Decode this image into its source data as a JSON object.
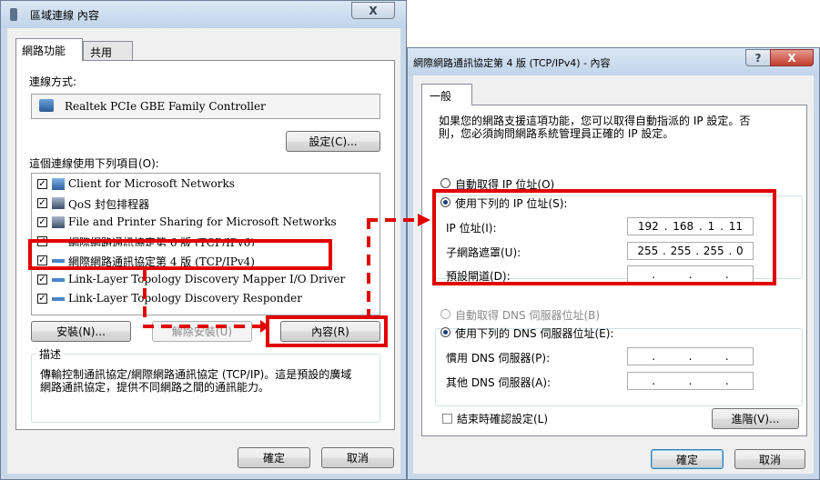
{
  "left_window": {
    "title": "區域連線 內容",
    "tabs": [
      "網路功能",
      "共用"
    ],
    "connect_using_label": "連線方式:",
    "adapter_name": "Realtek PCIe GBE Family Controller",
    "configure_button": "設定(C)...",
    "items_label": "這個連線使用下列項目(O):",
    "items": [
      {
        "label": "Client for Microsoft Networks",
        "checked": true
      },
      {
        "label": "QoS 封包排程器",
        "checked": true
      },
      {
        "label": "File and Printer Sharing for Microsoft Networks",
        "checked": true
      },
      {
        "label": "網際網路通訊協定第 6 版 (TCP/IPv6)",
        "checked": true
      },
      {
        "label": "網際網路通訊協定第 4 版 (TCP/IPv4)",
        "checked": true
      },
      {
        "label": "Link-Layer Topology Discovery Mapper I/O Driver",
        "checked": true
      },
      {
        "label": "Link-Layer Topology Discovery Responder",
        "checked": true
      }
    ],
    "install_button": "安裝(N)...",
    "uninstall_button": "解除安裝(U)",
    "properties_button": "內容(R)",
    "description_label": "描述",
    "description_text": "傳輸控制通訊協定/網際網路通訊協定 (TCP/IP)。這是預設的廣域網路通訊協定，提供不同網路之間的通訊能力。",
    "ok_button": "確定",
    "cancel_button": "取消",
    "close_glyph": "X"
  },
  "right_window": {
    "title": "網際網路通訊協定第 4 版 (TCP/IPv4) - 內容",
    "help_glyph": "?",
    "close_glyph": "X",
    "tab": "一般",
    "intro_text_1": "如果您的網路支援這項功能，您可以取得自動指派的 IP 設定。否",
    "intro_text_2": "則，您必須詢問網路系統管理員正確的 IP 設定。",
    "auto_ip_label": "自動取得 IP 位址(O)",
    "use_ip_label": "使用下列的 IP 位址(S):",
    "ip_address_label": "IP 位址(I):",
    "ip_address": [
      "192",
      "168",
      "1",
      "11"
    ],
    "subnet_label": "子網路遮罩(U):",
    "subnet_mask": [
      "255",
      "255",
      "255",
      "0"
    ],
    "gateway_label": "預設閘道(D):",
    "auto_dns_label": "自動取得 DNS 伺服器位址(B)",
    "use_dns_label": "使用下列的 DNS 伺服器位址(E):",
    "preferred_dns_label": "慣用 DNS 伺服器(P):",
    "alternate_dns_label": "其他 DNS 伺服器(A):",
    "validate_label": "結束時確認設定(L)",
    "advanced_button": "進階(V)...",
    "ok_button": "確定",
    "cancel_button": "取消"
  },
  "colors": {
    "highlight_red": "#e00000",
    "title_bar": "#bfd3ea",
    "close_red": "#c75050"
  }
}
